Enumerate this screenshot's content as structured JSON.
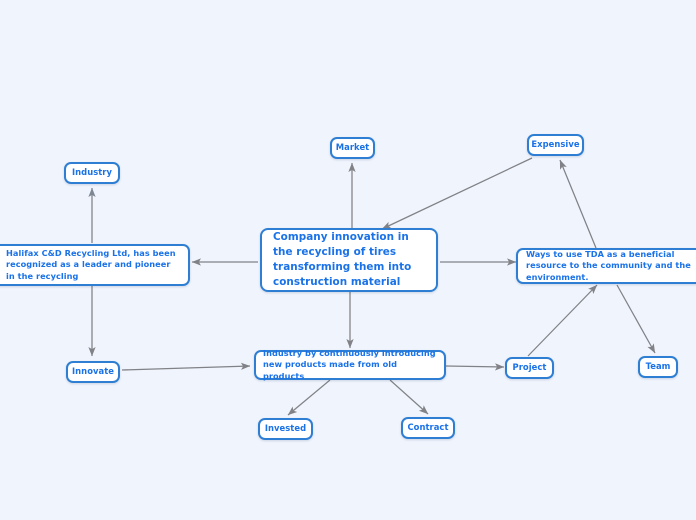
{
  "diagram": {
    "type": "mind-map",
    "title": "Company innovation in tires recycling mind map",
    "background_color": "#f0f4fc",
    "node_border_color": "#2e7fd4",
    "node_fill_color": "#ffffff",
    "node_text_color": "#1a72e8",
    "edge_color": "#808287",
    "nodes": [
      {
        "id": "central",
        "label": "Company innovation in the recycling of tires transforming them into construction material",
        "role": "root"
      },
      {
        "id": "halifax",
        "label": "Halifax C&D Recycling Ltd, has been recognized as a leader and pioneer in the recycling",
        "role": "branch"
      },
      {
        "id": "tda",
        "label": "Ways to use TDA as a beneficial resource to the community and the environment.",
        "role": "branch"
      },
      {
        "id": "industry-products",
        "label": "Industry by continuously introducing new products made from old products",
        "role": "branch"
      },
      {
        "id": "industry",
        "label": "Industry",
        "role": "leaf"
      },
      {
        "id": "market",
        "label": "Market",
        "role": "leaf"
      },
      {
        "id": "expensive",
        "label": "Expensive",
        "role": "leaf"
      },
      {
        "id": "innovate",
        "label": "Innovate",
        "role": "leaf"
      },
      {
        "id": "invested",
        "label": "Invested",
        "role": "leaf"
      },
      {
        "id": "contract",
        "label": "Contract",
        "role": "leaf"
      },
      {
        "id": "project",
        "label": "Project",
        "role": "leaf"
      },
      {
        "id": "team",
        "label": "Team",
        "role": "leaf"
      }
    ],
    "edges": [
      {
        "from": "industry",
        "to": "innovate"
      },
      {
        "from": "central",
        "to": "market"
      },
      {
        "from": "expensive",
        "to": "central"
      },
      {
        "from": "central",
        "to": "halifax"
      },
      {
        "from": "central",
        "to": "tda"
      },
      {
        "from": "central",
        "to": "industry-products"
      },
      {
        "from": "tda",
        "to": "expensive"
      },
      {
        "from": "project",
        "to": "tda"
      },
      {
        "from": "tda",
        "to": "team"
      },
      {
        "from": "innovate",
        "to": "industry-products"
      },
      {
        "from": "industry-products",
        "to": "invested"
      },
      {
        "from": "industry-products",
        "to": "contract"
      },
      {
        "from": "industry-products",
        "to": "project"
      }
    ]
  }
}
